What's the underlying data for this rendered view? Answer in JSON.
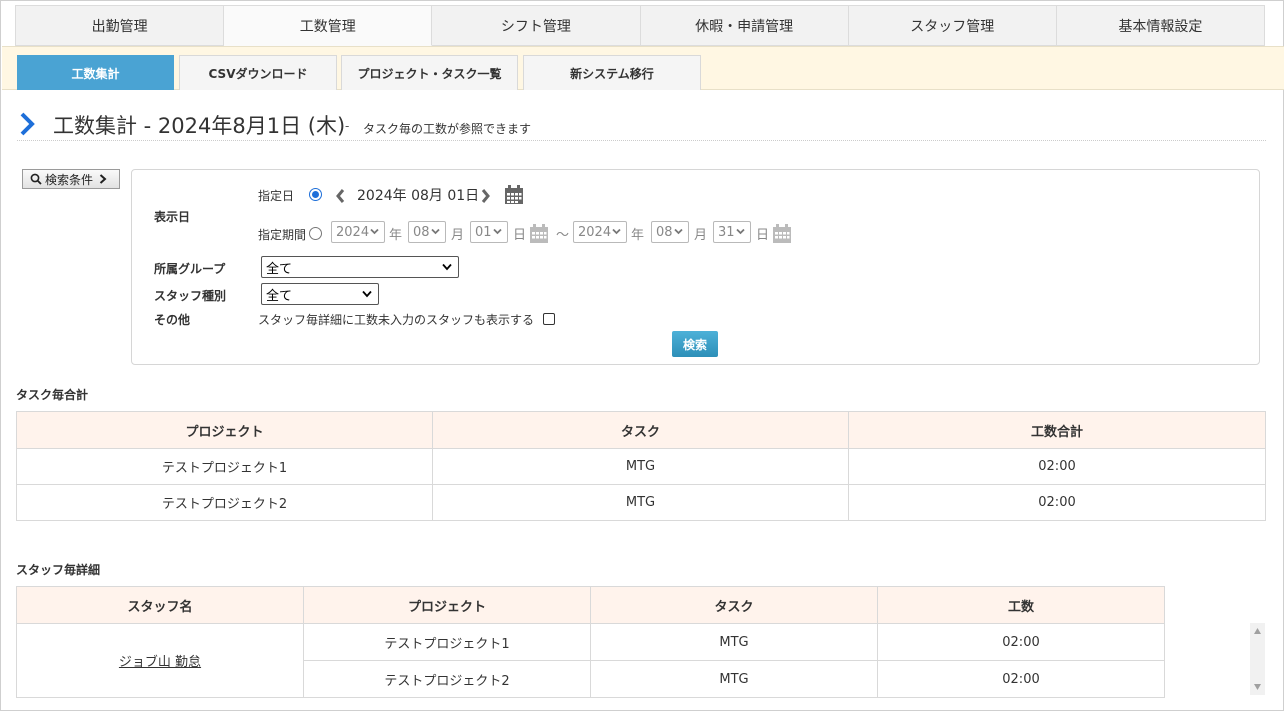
{
  "main_tabs": [
    "出勤管理",
    "工数管理",
    "シフト管理",
    "休暇・申請管理",
    "スタッフ管理",
    "基本情報設定"
  ],
  "sub_tabs": [
    "工数集計",
    "CSVダウンロード",
    "プロジェクト・タスク一覧",
    "新システム移行"
  ],
  "heading": {
    "title": "工数集計 - 2024年8月1日 (木)",
    "dash": "-",
    "subtitle": "タスク毎の工数が参照できます"
  },
  "search": {
    "toggle_label": "検索条件",
    "display_date_label": "表示日",
    "specified_date_label": "指定日",
    "specified_date_value": "2024年 08月 01日",
    "period_label": "指定期間",
    "period_start": {
      "year": "2024",
      "month": "08",
      "day": "01"
    },
    "period_end": {
      "year": "2024",
      "month": "08",
      "day": "31"
    },
    "year_unit": "年",
    "month_unit": "月",
    "day_unit": "日",
    "range_sep": "～",
    "group_label": "所属グループ",
    "group_value": "全て",
    "staff_type_label": "スタッフ種別",
    "staff_type_value": "全て",
    "other_label": "その他",
    "other_checkbox_label": "スタッフ毎詳細に工数未入力のスタッフも表示する",
    "submit_label": "検索"
  },
  "task_totals": {
    "title": "タスク毎合計",
    "headers": [
      "プロジェクト",
      "タスク",
      "工数合計"
    ],
    "rows": [
      [
        "テストプロジェクト1",
        "MTG",
        "02:00"
      ],
      [
        "テストプロジェクト2",
        "MTG",
        "02:00"
      ]
    ]
  },
  "staff_detail": {
    "title": "スタッフ毎詳細",
    "headers": [
      "スタッフ名",
      "プロジェクト",
      "タスク",
      "工数"
    ],
    "staff_name": "ジョブ山 勤怠",
    "rows": [
      [
        "テストプロジェクト1",
        "MTG",
        "02:00"
      ],
      [
        "テストプロジェクト2",
        "MTG",
        "02:00"
      ]
    ]
  },
  "colors": {
    "accent": "#4aa3d3",
    "sub_bar": "#fff7e3",
    "table_header": "#fff3ec",
    "heading_chevron": "#1e6fd9"
  }
}
